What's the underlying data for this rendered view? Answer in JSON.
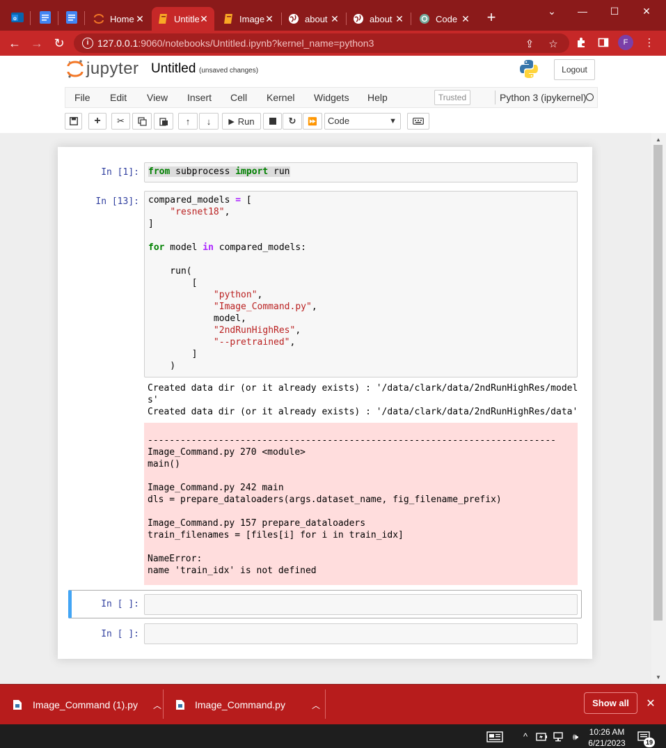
{
  "browser": {
    "tabs": [
      {
        "title": "Home",
        "icon": "jupyter-icon"
      },
      {
        "title": "Untitled",
        "icon": "notebook-icon",
        "active": true
      },
      {
        "title": "Image",
        "icon": "notebook-icon"
      },
      {
        "title": "about",
        "icon": "globe-icon"
      },
      {
        "title": "about",
        "icon": "globe-icon"
      },
      {
        "title": "Code",
        "icon": "openai-icon"
      }
    ],
    "url_host": "127.0.0.1",
    "url_path": ":9060/notebooks/Untitled.ipynb?kernel_name=python3",
    "profile_initial": "F",
    "accent_color": "#c62828",
    "titlebar_color": "#8b1a1a"
  },
  "jupyter": {
    "logo_text": "jupyter",
    "notebook_name": "Untitled",
    "save_status": "(unsaved changes)",
    "logout_label": "Logout",
    "menu": [
      "File",
      "Edit",
      "View",
      "Insert",
      "Cell",
      "Kernel",
      "Widgets",
      "Help"
    ],
    "trusted_label": "Trusted",
    "kernel_name": "Python 3 (ipykernel)",
    "run_label": "Run",
    "cell_type": "Code"
  },
  "cells": [
    {
      "prompt": "In [1]:",
      "code": "from subprocess import run"
    },
    {
      "prompt": "In [13]:",
      "code": "compared_models = [\n    \"resnet18\",\n]\n\nfor model in compared_models:\n\n    run(\n        [\n            \"python\",\n            \"Image_Command.py\",\n            model,\n            \"2ndRunHighRes\",\n            \"--pretrained\",\n        ]\n    )",
      "stdout": "Created data dir (or it already exists) : '/data/clark/data/2ndRunHighRes/model\ns'\nCreated data dir (or it already exists) : '/data/clark/data/2ndRunHighRes/data'",
      "stderr": "\n---------------------------------------------------------------------------\nImage_Command.py 270 <module>\nmain()\n\nImage_Command.py 242 main\ndls = prepare_dataloaders(args.dataset_name, fig_filename_prefix)\n\nImage_Command.py 157 prepare_dataloaders\ntrain_filenames = [files[i] for i in train_idx]\n\nNameError:\nname 'train_idx' is not defined"
    },
    {
      "prompt": "In [ ]:",
      "code": ""
    },
    {
      "prompt": "In [ ]:",
      "code": ""
    }
  ],
  "downloads": {
    "items": [
      "Image_Command (1).py",
      "Image_Command.py"
    ],
    "show_all_label": "Show all"
  },
  "taskbar": {
    "time": "10:26 AM",
    "date": "6/21/2023",
    "notification_count": "19"
  }
}
